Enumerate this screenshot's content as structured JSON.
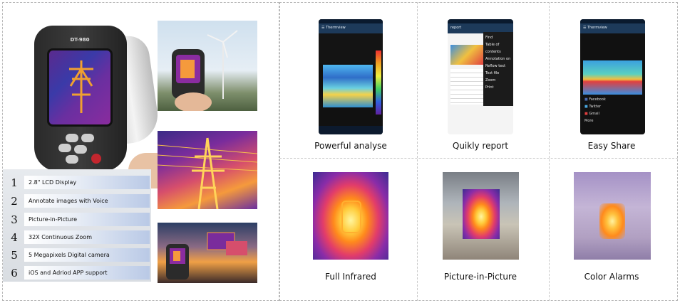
{
  "camera": {
    "model_label": "DT-980",
    "colors": {
      "body": "#2a2a2a",
      "handle": "#e8e8e8",
      "power": "#c3262e"
    }
  },
  "features": [
    {
      "num": "1",
      "text": "2.8\" LCD Display"
    },
    {
      "num": "2",
      "text": "Annotate images with Voice"
    },
    {
      "num": "3",
      "text": "Picture-in-Picture"
    },
    {
      "num": "4",
      "text": "32X Continuous Zoom"
    },
    {
      "num": "5",
      "text": "5 Megapixels Digital camera"
    },
    {
      "num": "6",
      "text": "iOS and Adriod APP support"
    }
  ],
  "app_screens": [
    {
      "caption": "Powerful analyse",
      "appbar_title": "Thermview"
    },
    {
      "caption": "Quikly report",
      "appbar_title": "report",
      "menu": [
        "Find",
        "Table of contents",
        "Annotation on",
        "Reflow text",
        "Text file",
        "Zoom",
        "Print"
      ]
    },
    {
      "caption": "Easy Share",
      "appbar_title": "Thermview",
      "share_options": [
        "Facebook",
        "Twitter",
        "Gmail",
        "More"
      ]
    }
  ],
  "modes": [
    {
      "caption": "Full Infrared"
    },
    {
      "caption": "Picture-in-Picture"
    },
    {
      "caption": "Color Alarms"
    }
  ],
  "icons": [
    "menu-icon",
    "search-icon",
    "facebook-icon",
    "twitter-icon",
    "gmail-icon",
    "power-icon"
  ]
}
